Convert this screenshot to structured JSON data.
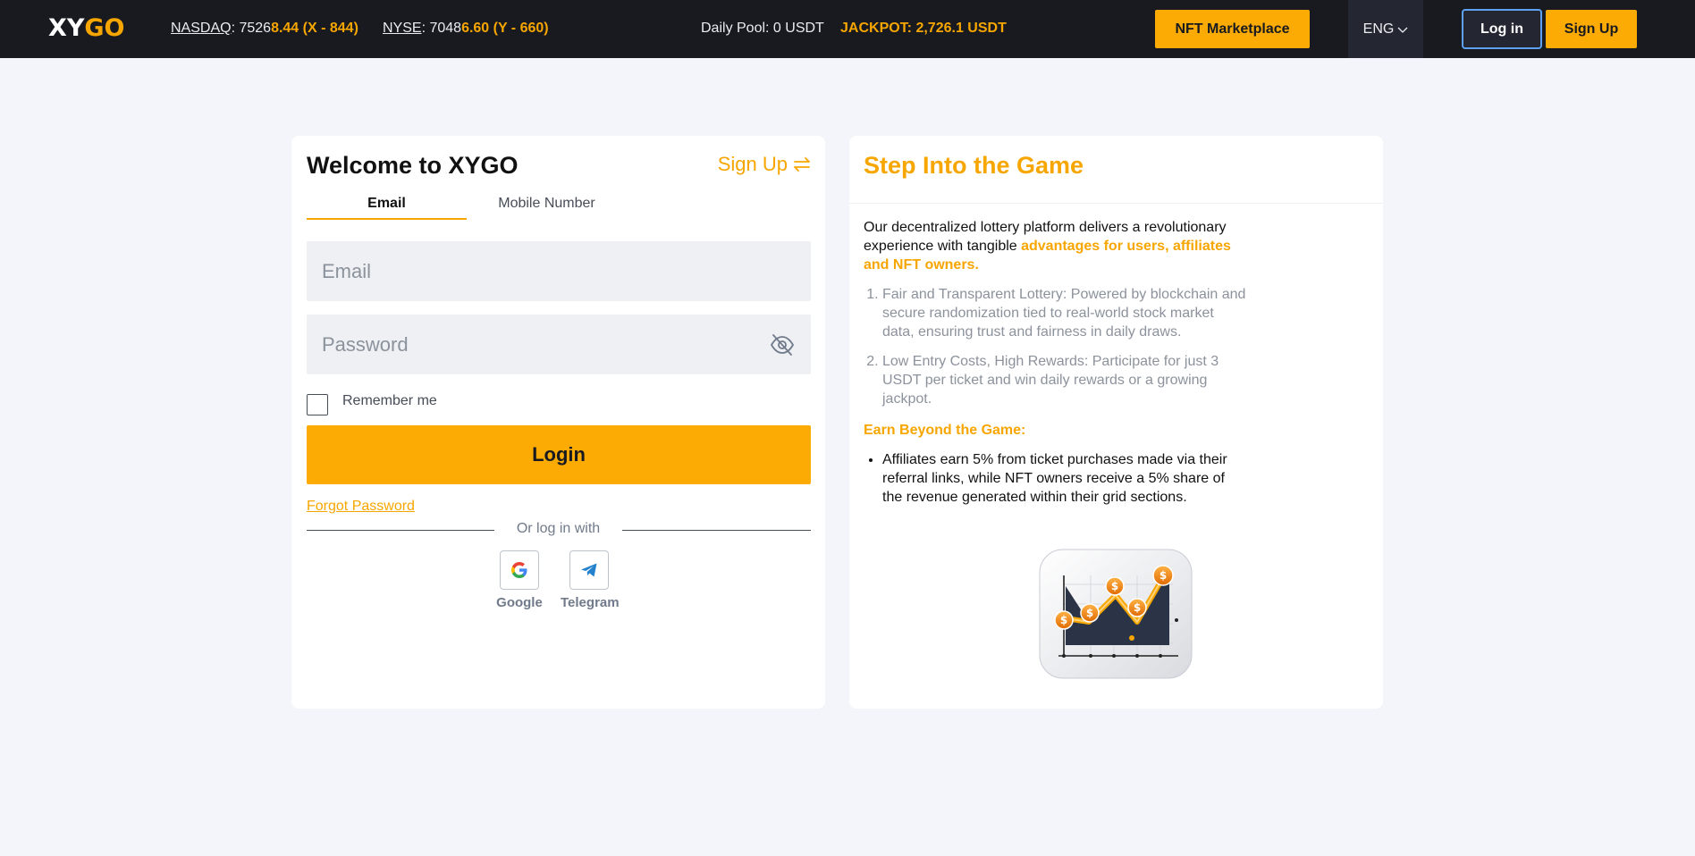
{
  "header": {
    "logo_xy": "XY",
    "logo_go": "GO",
    "nasdaq": {
      "name": "NASDAQ",
      "sep": ": ",
      "prefix": "7526",
      "highlight": "8.44 (X - 844)"
    },
    "nyse": {
      "name": "NYSE",
      "sep": ": ",
      "prefix": "7048",
      "highlight": "6.60 (Y - 660)"
    },
    "daily_pool": "Daily Pool: 0 USDT",
    "jackpot": "JACKPOT: 2,726.1 USDT",
    "nft_marketplace": "NFT Marketplace",
    "language": "ENG",
    "login": "Log in",
    "signup": "Sign Up"
  },
  "login_card": {
    "title": "Welcome to XYGO",
    "signup_link": "Sign Up",
    "tabs": [
      "Email",
      "Mobile Number"
    ],
    "email_placeholder": "Email",
    "password_placeholder": "Password",
    "remember_me": "Remember me",
    "login_button": "Login",
    "forgot_password": "Forgot Password",
    "or_login_with": "Or log in with",
    "social": [
      "Google",
      "Telegram"
    ]
  },
  "info_card": {
    "title": "Step Into the Game",
    "intro": "Our decentralized lottery platform delivers a revolutionary experience with tangible ",
    "intro_accent": "advantages for users, affiliates and NFT owners.",
    "points": [
      "Fair and Transparent Lottery: Powered by blockchain and secure randomization tied to real-world stock market data, ensuring trust and fairness in daily draws.",
      "Low Entry Costs, High Rewards: Participate for just 3 USDT per ticket and win daily rewards or a growing jackpot."
    ],
    "earn_title": "Earn Beyond the Game:",
    "affiliates": "Affiliates earn 5% from ticket purchases made via their referral links, while NFT owners receive a 5% share of the revenue generated within their grid sections."
  },
  "colors": {
    "accent": "#f7a600",
    "button": "#fcab04",
    "header_bg": "#181a20",
    "page_bg": "#f3f5fa"
  },
  "icons": [
    "swap-icon",
    "eye-off-icon",
    "chevron-down-icon",
    "google-icon",
    "telegram-icon"
  ]
}
